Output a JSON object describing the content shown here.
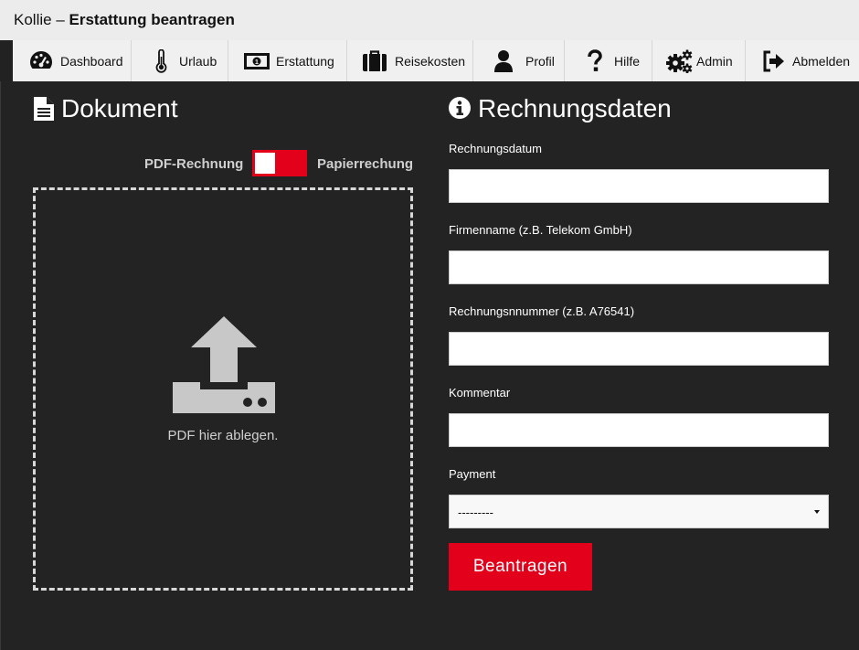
{
  "window": {
    "app_name": "Kollie",
    "separator": " – ",
    "page_title": "Erstattung beantragen"
  },
  "nav": {
    "items": [
      {
        "label": "Dashboard",
        "icon": "dashboard-icon"
      },
      {
        "label": "Urlaub",
        "icon": "thermometer-icon"
      },
      {
        "label": "Erstattung",
        "icon": "money-bill-icon"
      },
      {
        "label": "Reisekosten",
        "icon": "suitcase-icon"
      },
      {
        "label": "Profil",
        "icon": "user-icon"
      },
      {
        "label": "Hilfe",
        "icon": "question-icon"
      },
      {
        "label": "Admin",
        "icon": "cogs-icon"
      },
      {
        "label": "Abmelden",
        "icon": "sign-out-icon"
      }
    ]
  },
  "document": {
    "heading": "Dokument",
    "toggle_left": "PDF-Rechnung",
    "toggle_right": "Papierrechung",
    "drop_text": "PDF hier ablegen."
  },
  "invoice": {
    "heading": "Rechnungsdaten",
    "fields": [
      {
        "label": "Rechnungsdatum",
        "value": ""
      },
      {
        "label": "Firmenname (z.B. Telekom GmbH)",
        "value": ""
      },
      {
        "label": "Rechnungsnnummer (z.B. A76541)",
        "value": ""
      },
      {
        "label": "Kommentar",
        "value": ""
      }
    ],
    "payment_label": "Payment",
    "payment_selected": "---------",
    "submit_label": "Beantragen"
  },
  "colors": {
    "accent": "#e2001a",
    "panel_bg": "#232323",
    "nav_bg": "#f0f0f0"
  }
}
